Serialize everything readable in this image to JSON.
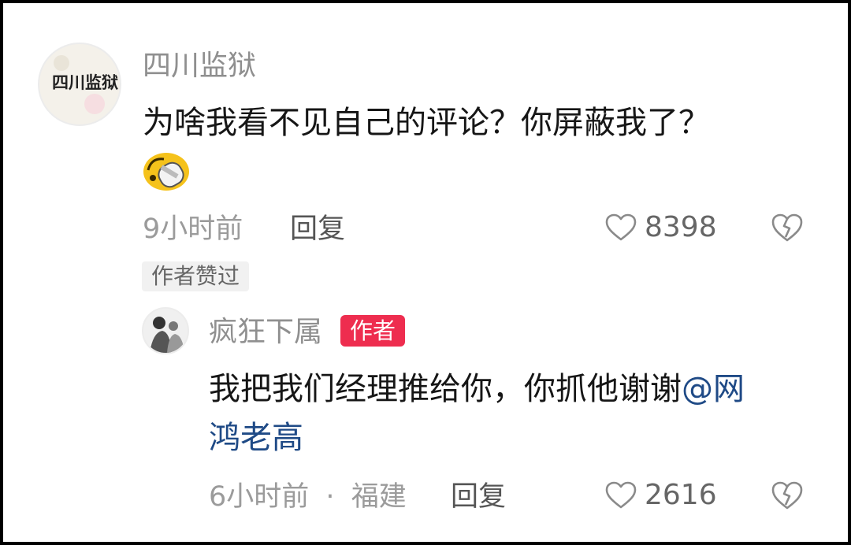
{
  "comment": {
    "username": "四川监狱",
    "avatar_text": "四川监狱",
    "text": "为啥我看不见自己的评论？你屏蔽我了？",
    "emoji": "slipper-emoji",
    "time": "9小时前",
    "reply_label": "回复",
    "likes": "8398",
    "tag": "作者赞过"
  },
  "reply": {
    "username": "疯狂下属",
    "badge": "作者",
    "text_line1": "我把我们经理推给你，你抓他谢谢",
    "mention_part1": "@网",
    "mention_part2": "鸿老高",
    "time": "6小时前",
    "separator": "·",
    "location": "福建",
    "reply_label": "回复",
    "likes": "2616"
  },
  "colors": {
    "author_badge": "#ee2d4f",
    "mention": "#1f4a86",
    "meta": "#9b9b9b"
  }
}
